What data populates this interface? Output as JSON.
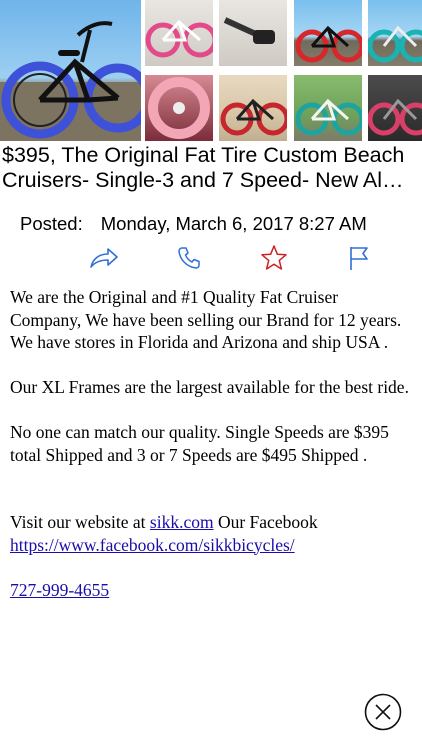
{
  "listing": {
    "title": "$395, The Original Fat Tire Custom Beach Cruisers- Single-3 and 7 Speed- New Al…",
    "posted_label": "Posted:",
    "posted_date": "Monday, March 6, 2017 8:27 AM"
  },
  "actions": {
    "share_icon": "share-arrow-icon",
    "call_icon": "phone-icon",
    "favorite_icon": "star-icon",
    "flag_icon": "flag-icon"
  },
  "description": {
    "p1": "We are the Original and #1 Quality Fat Cruiser Company, We have been selling our Brand for 12 years. We have stores in Florida and Arizona and ship USA .",
    "p2": "Our XL Frames are the largest available for the best ride.",
    "p3": "No one can match our quality. Single Speeds are $395 total Shipped and 3 or 7 Speeds are $495 Shipped .",
    "visit_prefix": "Visit our website at",
    "website_link": "sikk.com",
    "facebook_prefix": "Our Facebook",
    "facebook_link": "https://www.facebook.com/sikkbicycles/",
    "phone_link": "727-999-4655"
  },
  "colors": {
    "action_blue": "#2f6fd6",
    "favorite_red": "#cc2222",
    "link_blue": "#1a0dab"
  }
}
